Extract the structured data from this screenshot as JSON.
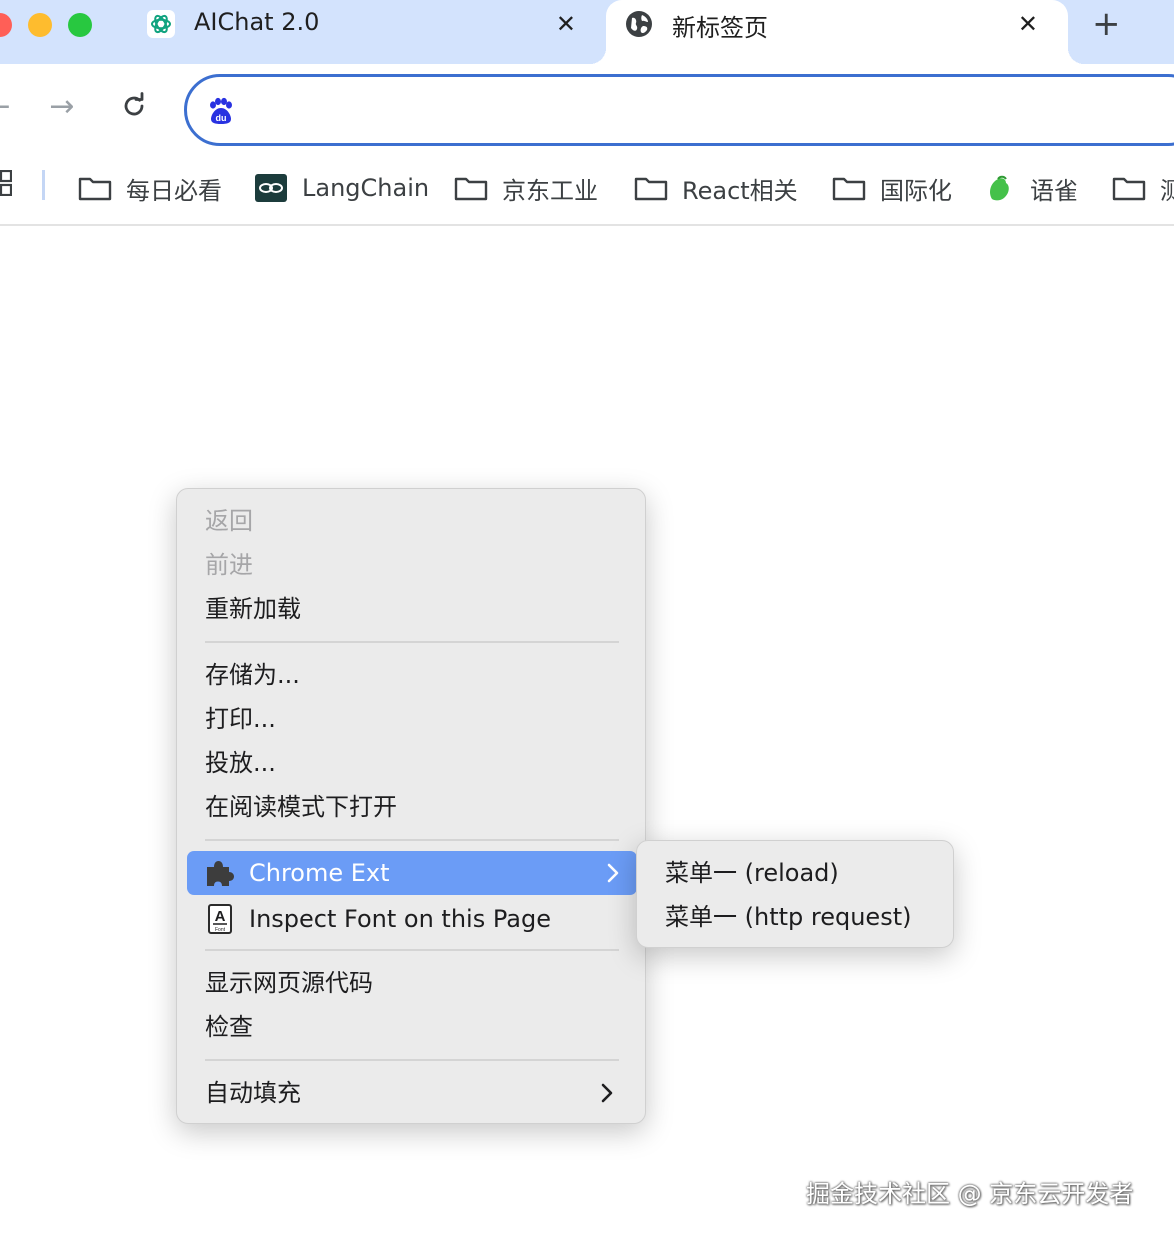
{
  "tabs": [
    {
      "title": "AIChat 2.0",
      "favicon": "openai-icon",
      "active": false,
      "close_label": "✕"
    },
    {
      "title": "新标签页",
      "favicon": "globe-icon",
      "active": true,
      "close_label": "✕"
    }
  ],
  "new_tab_label": "+",
  "toolbar": {
    "back_glyph": "←",
    "forward_glyph": "→",
    "reload_glyph": "↻",
    "omnibox": {
      "value": "",
      "site_icon": "baidu-paw-icon"
    }
  },
  "bookmarks": [
    {
      "label": "每日必看",
      "icon": "folder-icon"
    },
    {
      "label": "LangChain",
      "icon": "langchain-icon"
    },
    {
      "label": "京东工业",
      "icon": "folder-icon"
    },
    {
      "label": "React相关",
      "icon": "folder-icon"
    },
    {
      "label": "国际化",
      "icon": "folder-icon"
    },
    {
      "label": "语雀",
      "icon": "yuque-icon"
    },
    {
      "label": "测",
      "icon": "folder-icon"
    }
  ],
  "context_menu": {
    "back": "返回",
    "forward": "前进",
    "reload": "重新加载",
    "save_as": "存储为...",
    "print": "打印...",
    "cast": "投放...",
    "reading_mode": "在阅读模式下打开",
    "chrome_ext": "Chrome Ext",
    "inspect_font": "Inspect Font on this Page",
    "view_source": "显示网页源代码",
    "inspect": "检查",
    "autofill": "自动填充"
  },
  "submenu": {
    "items": [
      "菜单一 (reload)",
      "菜单一 (http request)"
    ]
  },
  "watermark": "掘金技术社区 @ 京东云开发者",
  "colors": {
    "tabstrip": "#d3e3fd",
    "omnibox_border": "#3c6fd0",
    "menu_bg": "#ebebeb",
    "menu_highlight": "#6b9cf6"
  }
}
